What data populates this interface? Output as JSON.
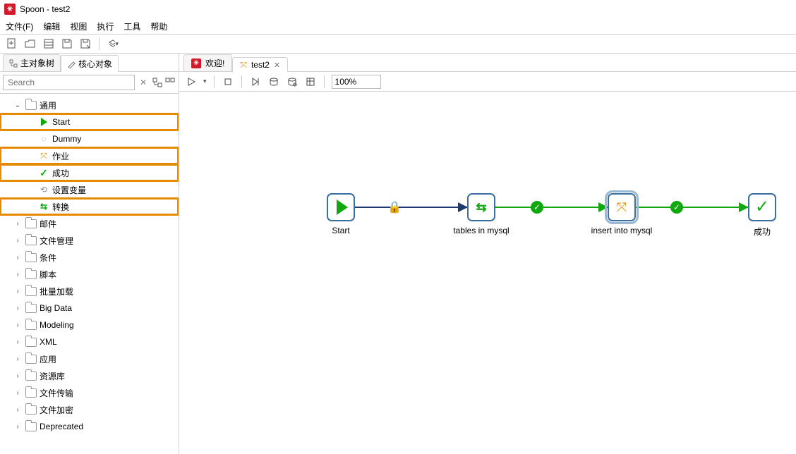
{
  "title": "Spoon - test2",
  "menu": {
    "file": "文件(F)",
    "edit": "编辑",
    "view": "视图",
    "run": "执行",
    "tools": "工具",
    "help": "帮助"
  },
  "side_tabs": {
    "main_tree": "主对象树",
    "core_objects": "核心对象"
  },
  "search": {
    "placeholder": "Search"
  },
  "tree": {
    "general": {
      "label": "通用",
      "start": "Start",
      "dummy": "Dummy",
      "job": "作业",
      "success": "成功",
      "setvar": "设置变量",
      "transform": "转换"
    },
    "folders": [
      "邮件",
      "文件管理",
      "条件",
      "脚本",
      "批量加载",
      "Big Data",
      "Modeling",
      "XML",
      "应用",
      "资源库",
      "文件传输",
      "文件加密",
      "Deprecated"
    ]
  },
  "doc_tabs": {
    "welcome": "欢迎!",
    "test2": "test2"
  },
  "canvas_toolbar": {
    "zoom": "100%"
  },
  "flow": {
    "start": "Start",
    "tables": "tables in mysql",
    "insert": "insert into mysql",
    "success": "成功"
  }
}
